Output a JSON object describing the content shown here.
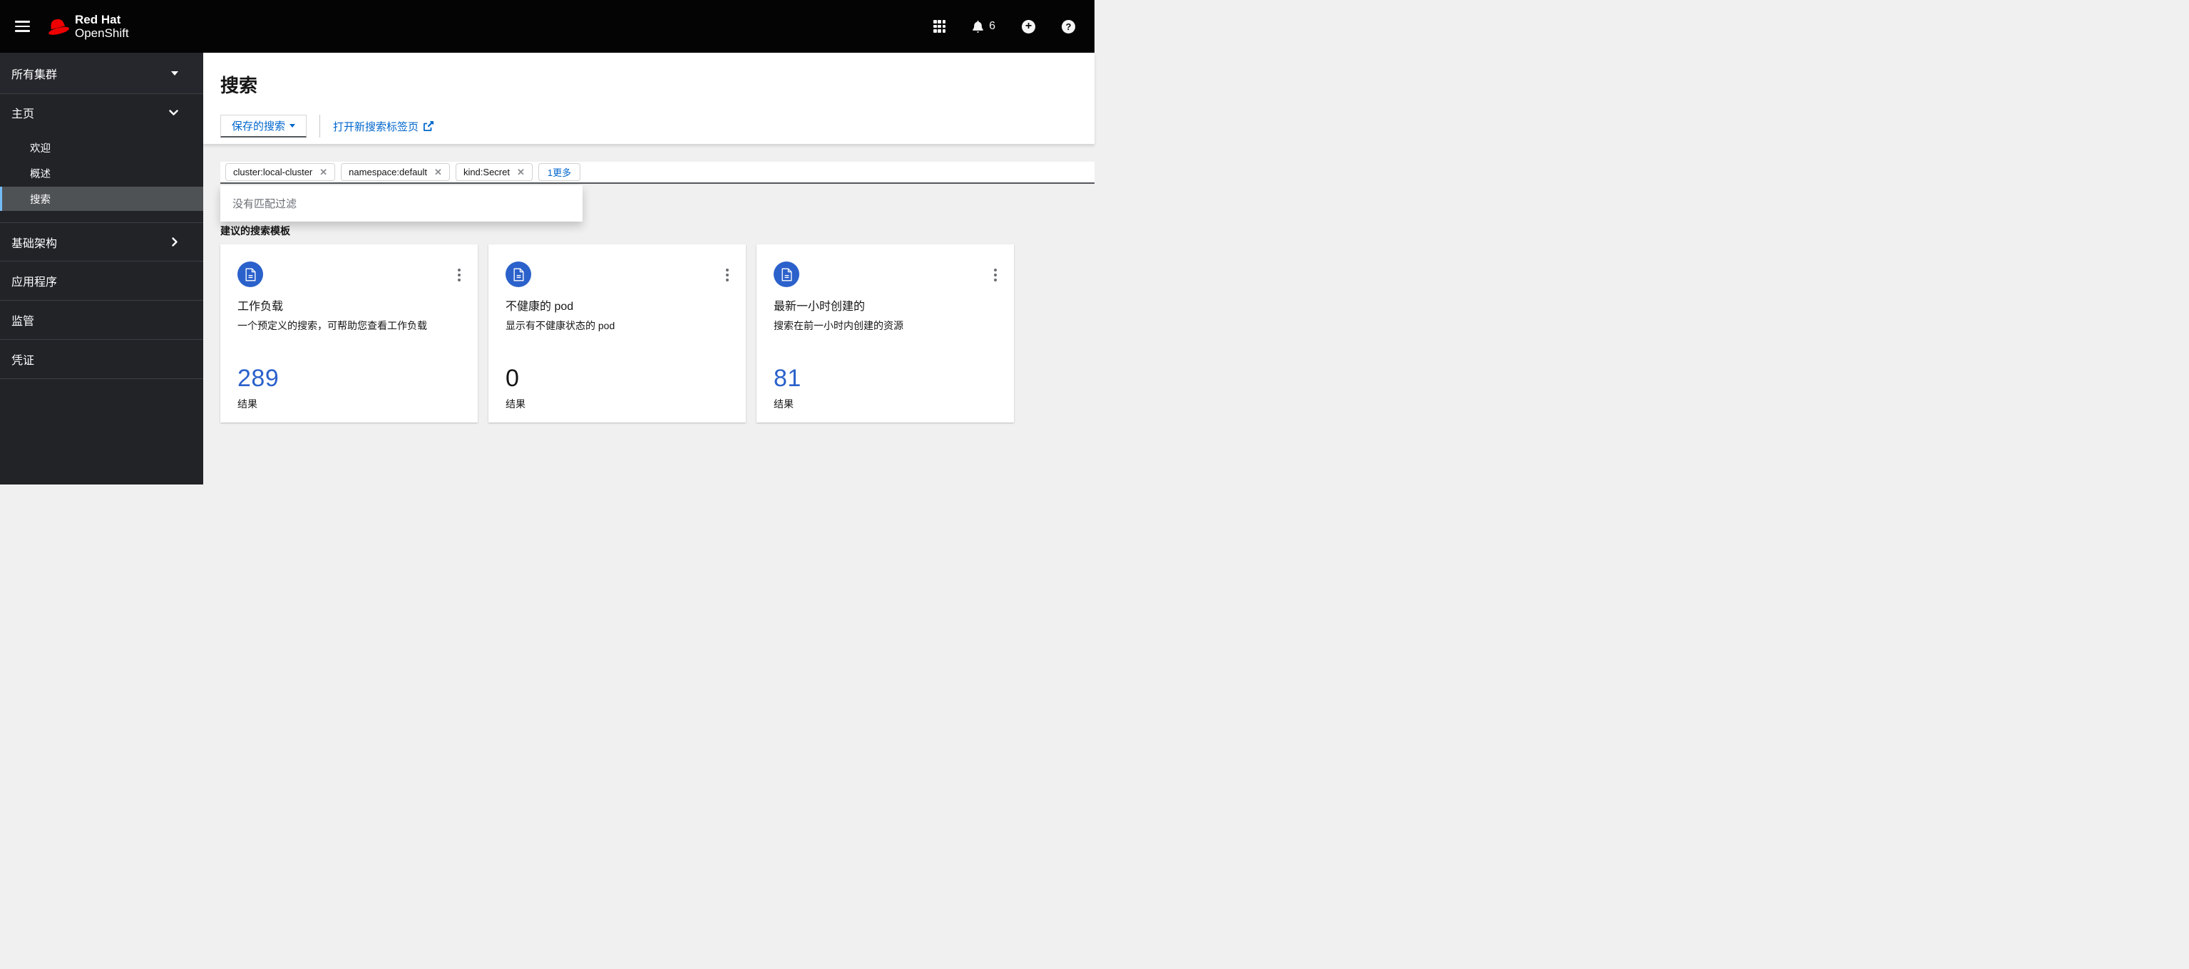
{
  "header": {
    "logo": {
      "line1": "Red Hat",
      "line2": "OpenShift"
    },
    "notifications": {
      "count": "6"
    }
  },
  "sidebar": {
    "cluster_selector": {
      "label": "所有集群"
    },
    "home_group": {
      "label": "主页",
      "items": [
        {
          "label": "欢迎"
        },
        {
          "label": "概述"
        },
        {
          "label": "搜索",
          "selected": true
        }
      ]
    },
    "groups": [
      {
        "label": "基础架构"
      },
      {
        "label": "应用程序"
      },
      {
        "label": "监管"
      },
      {
        "label": "凭证"
      }
    ]
  },
  "main": {
    "title": "搜索",
    "toolbar": {
      "saved_searches_label": "保存的搜索",
      "open_new_tab_label": "打开新搜索标签页"
    },
    "search": {
      "chips": [
        {
          "text": "cluster:local-cluster"
        },
        {
          "text": "namespace:default"
        },
        {
          "text": "kind:Secret"
        }
      ],
      "more_label": "1更多",
      "dropdown_message": "没有匹配过滤"
    },
    "suggestions": {
      "heading": "建议的搜索模板",
      "cards": [
        {
          "title": "工作负载",
          "description": "一个预定义的搜索，可帮助您查看工作负载",
          "count": "289",
          "result_label": "结果"
        },
        {
          "title": "不健康的 pod",
          "description": "显示有不健康状态的 pod",
          "count": "0",
          "result_label": "结果"
        },
        {
          "title": "最新一小时创建的",
          "description": "搜索在前一小时内创建的资源",
          "count": "81",
          "result_label": "结果"
        }
      ]
    }
  },
  "icons": {
    "close": "✕"
  },
  "colors": {
    "masthead_bg": "#040404",
    "sidebar_bg": "#212327",
    "selected_nav_bg": "#4f5255",
    "selected_nav_accent": "#73bcf7",
    "link_blue": "#0066cc",
    "accent_blue": "#2b61cb",
    "brand_red": "#ee0000",
    "content_bg": "#f0f0f0"
  }
}
